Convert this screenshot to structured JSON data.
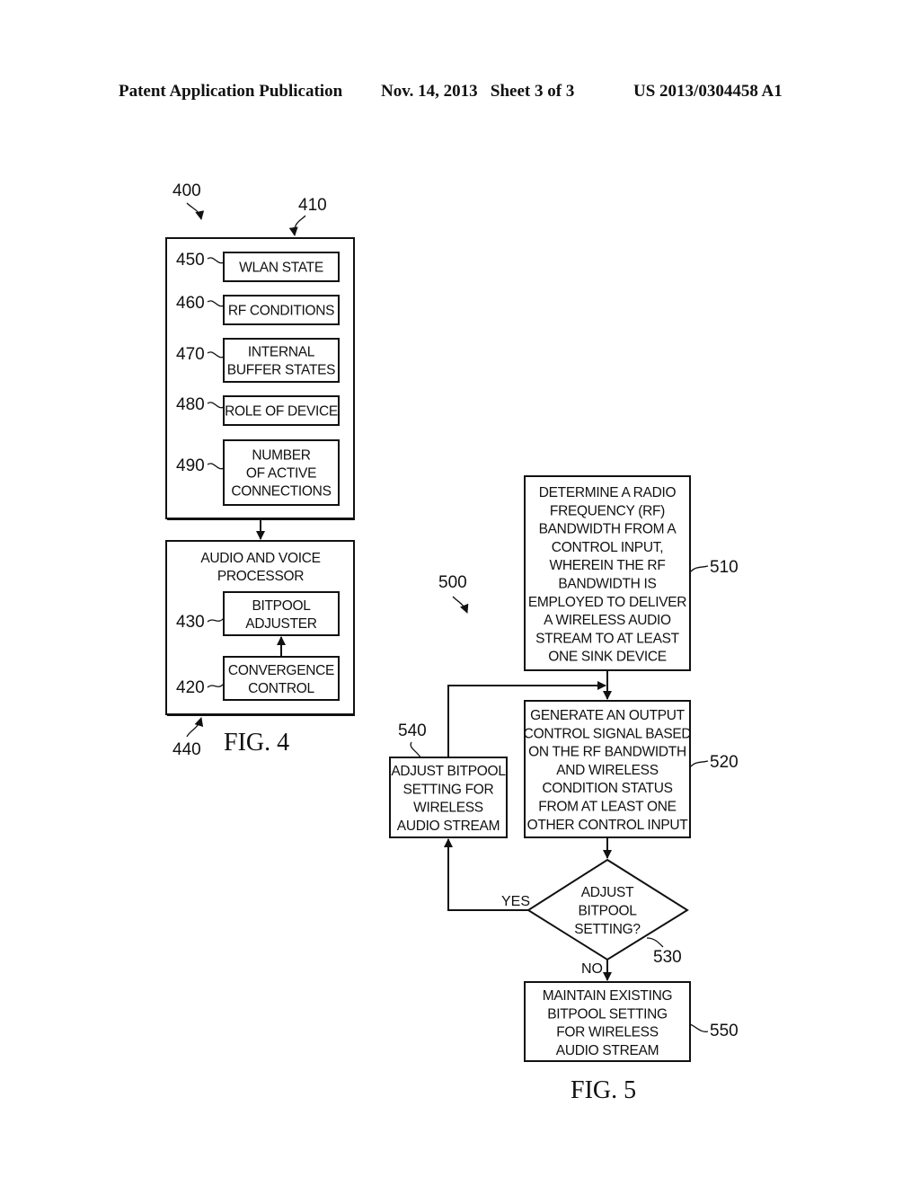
{
  "header": {
    "publication": "Patent Application Publication",
    "date_sheet": "Nov. 14, 2013   Sheet 3 of 3",
    "patent_number": "US 2013/0304458 A1"
  },
  "fig4": {
    "caption": "FIG. 4",
    "ref_system": "400",
    "ref_outer_box": "410",
    "ref_processor": "440",
    "inputs": [
      {
        "ref": "450",
        "lines": [
          "WLAN STATE"
        ]
      },
      {
        "ref": "460",
        "lines": [
          "RF CONDITIONS"
        ]
      },
      {
        "ref": "470",
        "lines": [
          "INTERNAL",
          "BUFFER STATES"
        ]
      },
      {
        "ref": "480",
        "lines": [
          "ROLE OF DEVICE"
        ]
      },
      {
        "ref": "490",
        "lines": [
          "NUMBER",
          "OF ACTIVE",
          "CONNECTIONS"
        ]
      }
    ],
    "processor": {
      "title_lines": [
        "AUDIO AND VOICE",
        "PROCESSOR"
      ],
      "bitpool_adjuster": {
        "ref": "430",
        "lines": [
          "BITPOOL",
          "ADJUSTER"
        ]
      },
      "convergence_control": {
        "ref": "420",
        "lines": [
          "CONVERGENCE",
          "CONTROL"
        ]
      }
    }
  },
  "fig5": {
    "caption": "FIG. 5",
    "ref_method": "500",
    "step_510": {
      "ref": "510",
      "lines": [
        "DETERMINE A RADIO",
        "FREQUENCY (RF)",
        "BANDWIDTH FROM A",
        "CONTROL INPUT,",
        "WHEREIN THE RF",
        "BANDWIDTH IS",
        "EMPLOYED TO DELIVER",
        "A WIRELESS AUDIO",
        "STREAM TO AT LEAST",
        "ONE SINK DEVICE"
      ]
    },
    "step_520": {
      "ref": "520",
      "lines": [
        "GENERATE AN OUTPUT",
        "CONTROL SIGNAL BASED",
        "ON THE RF BANDWIDTH",
        "AND WIRELESS",
        "CONDITION STATUS",
        "FROM AT LEAST ONE",
        "OTHER CONTROL INPUT"
      ]
    },
    "decision_530": {
      "ref": "530",
      "lines": [
        "ADJUST",
        "BITPOOL",
        "SETTING?"
      ],
      "yes_label": "YES",
      "no_label": "NO"
    },
    "step_540": {
      "ref": "540",
      "lines": [
        "ADJUST BITPOOL",
        "SETTING FOR",
        "WIRELESS",
        "AUDIO STREAM"
      ]
    },
    "step_550": {
      "ref": "550",
      "lines": [
        "MAINTAIN EXISTING",
        "BITPOOL SETTING",
        "FOR WIRELESS",
        "AUDIO STREAM"
      ]
    }
  }
}
